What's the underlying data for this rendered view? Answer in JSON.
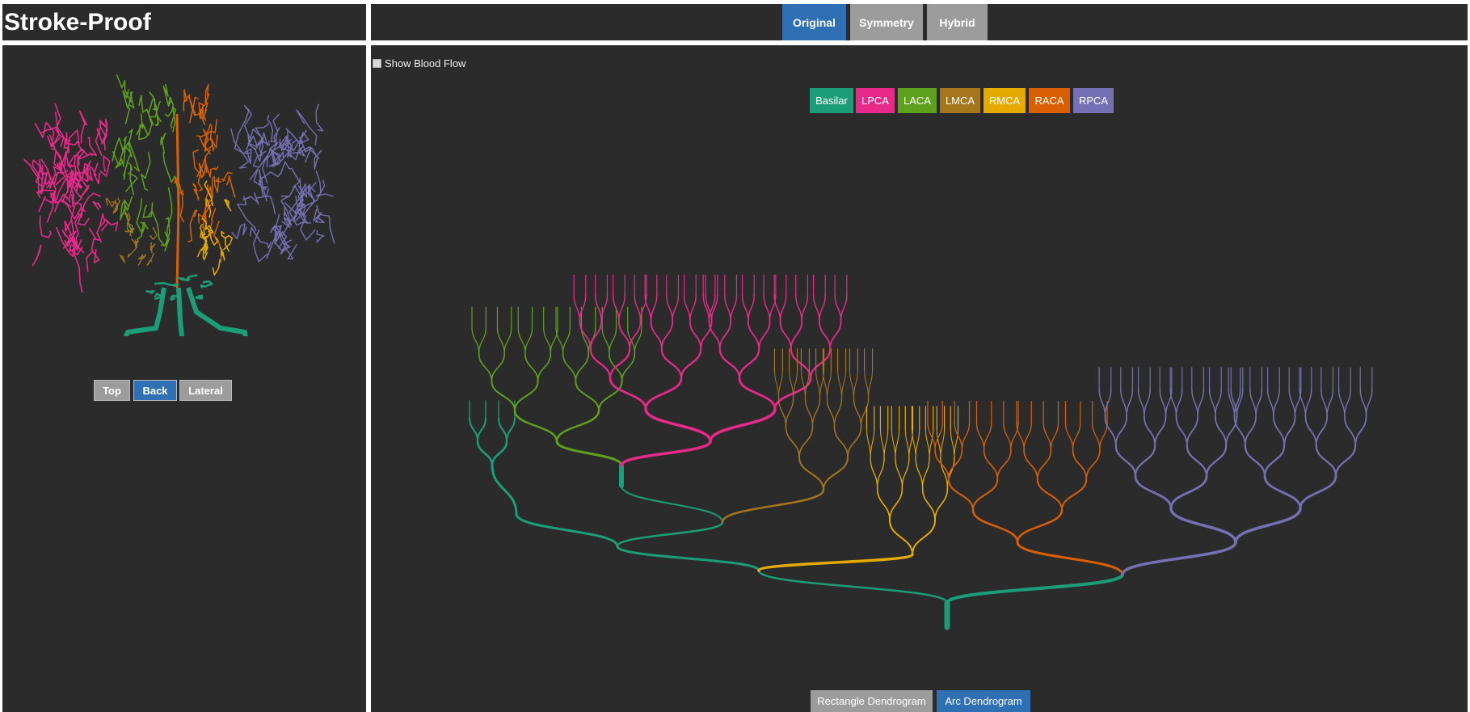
{
  "app": {
    "title": "Stroke-Proof"
  },
  "tabs": [
    {
      "label": "Original",
      "active": true
    },
    {
      "label": "Symmetry",
      "active": false
    },
    {
      "label": "Hybrid",
      "active": false
    }
  ],
  "view_buttons": [
    {
      "label": "Top",
      "active": false
    },
    {
      "label": "Back",
      "active": true
    },
    {
      "label": "Lateral",
      "active": false
    }
  ],
  "options": {
    "show_blood_flow_label": "Show Blood Flow",
    "show_blood_flow_checked": false
  },
  "legend": [
    {
      "label": "Basilar",
      "color": "#1b9e77"
    },
    {
      "label": "LPCA",
      "color": "#e7298a"
    },
    {
      "label": "LACA",
      "color": "#5ea11d"
    },
    {
      "label": "LMCA",
      "color": "#a6761d"
    },
    {
      "label": "RMCA",
      "color": "#e6ab02"
    },
    {
      "label": "RACA",
      "color": "#d95f02"
    },
    {
      "label": "RPCA",
      "color": "#7570b3"
    }
  ],
  "dendrogram_buttons": [
    {
      "label": "Rectangle Dendrogram",
      "active": false
    },
    {
      "label": "Arc Dendrogram",
      "active": true
    }
  ],
  "colors": {
    "panel": "#2b2b2b",
    "active": "#2f6fb3",
    "inactive": "#9c9c9c"
  }
}
